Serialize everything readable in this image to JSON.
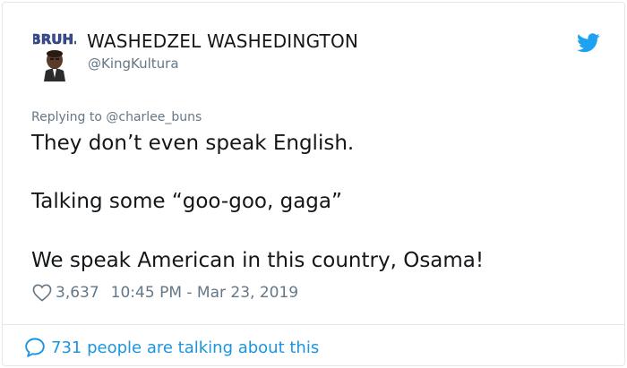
{
  "author": {
    "display_name": "WASHEDZEL WASHEDINGTON",
    "handle": "@KingKultura",
    "avatar_text": "BRUH."
  },
  "reply": {
    "prefix": "Replying to ",
    "mention": "@charlee_buns"
  },
  "tweet": {
    "lines": [
      "They don’t even speak English.",
      "Talking some “goo-goo, gaga”",
      "We speak American in this country, Osama!"
    ]
  },
  "meta": {
    "likes": "3,637",
    "timestamp": "10:45 PM - Mar 23, 2019"
  },
  "footer": {
    "talking": "731 people are talking about this"
  },
  "colors": {
    "text": "#14171a",
    "secondary": "#657786",
    "accent": "#1b95e0",
    "twitter_blue": "#1da1f2",
    "border": "#e1e8ed"
  },
  "icons": {
    "brand": "twitter-bird-icon",
    "like": "heart-icon",
    "reply": "speech-bubble-icon"
  }
}
